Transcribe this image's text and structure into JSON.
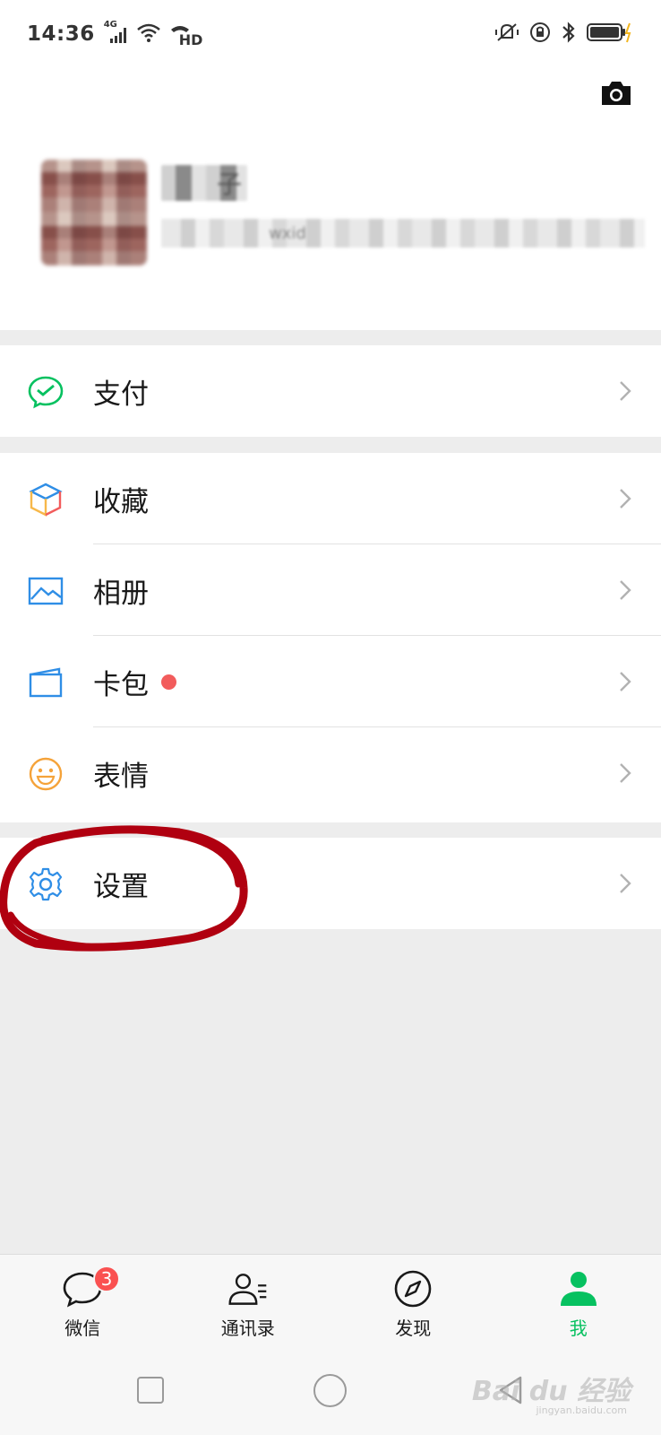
{
  "status_bar": {
    "time": "14:36",
    "network": "4G",
    "hd": "HD",
    "icons": [
      "signal-icon",
      "wifi-icon",
      "hd-call-icon",
      "vibrate-icon",
      "rotation-lock-icon",
      "bluetooth-icon",
      "battery-charging-icon"
    ]
  },
  "profile": {
    "camera_icon": "camera-icon",
    "name_visible": "子",
    "wxid_prefix": "wxid"
  },
  "menu_groups": [
    {
      "items": [
        {
          "label": "支付",
          "icon": "pay-icon",
          "color": "#07c160"
        }
      ]
    },
    {
      "items": [
        {
          "label": "收藏",
          "icon": "favorites-cube-icon",
          "color": "#f7b84a"
        },
        {
          "label": "相册",
          "icon": "album-icon",
          "color": "#2f8ee6"
        },
        {
          "label": "卡包",
          "icon": "card-wallet-icon",
          "color": "#2f8ee6",
          "red_dot": true
        },
        {
          "label": "表情",
          "icon": "sticker-smile-icon",
          "color": "#f5a33a"
        }
      ]
    },
    {
      "items": [
        {
          "label": "设置",
          "icon": "settings-gear-icon",
          "color": "#2f8ee6"
        }
      ]
    }
  ],
  "tabbar": {
    "tabs": [
      {
        "label": "微信",
        "icon": "chat-bubble-icon",
        "badge": "3"
      },
      {
        "label": "通讯录",
        "icon": "contacts-icon"
      },
      {
        "label": "发现",
        "icon": "compass-icon"
      },
      {
        "label": "我",
        "icon": "me-person-icon",
        "active": true
      }
    ],
    "active_color": "#07c160"
  },
  "watermark": {
    "text": "Bai du 经验",
    "sub": "jingyan.baidu.com"
  },
  "annotation_color": "#b00010"
}
